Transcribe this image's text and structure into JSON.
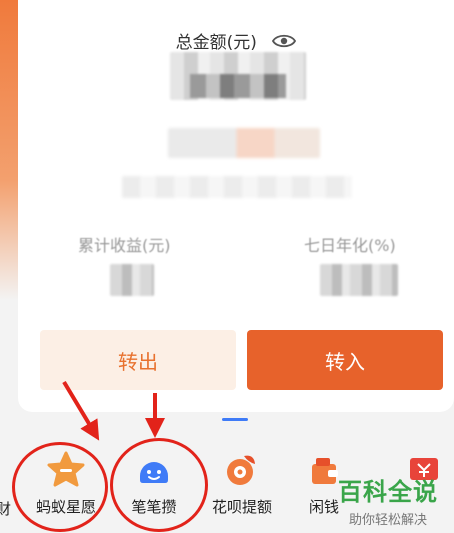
{
  "balance": {
    "title": "总金额(元)",
    "eye_icon": "eye-icon"
  },
  "stats": {
    "left_label": "累计收益(元)",
    "right_label": "七日年化(%)"
  },
  "actions": {
    "transfer_out": "转出",
    "transfer_in": "转入"
  },
  "nav": {
    "items": [
      {
        "label": "财",
        "icon": "partial-icon"
      },
      {
        "label": "蚂蚁星愿",
        "icon": "star-icon"
      },
      {
        "label": "笔笔攒",
        "icon": "smile-icon"
      },
      {
        "label": "花呗提额",
        "icon": "huabei-icon"
      },
      {
        "label": "闲钱",
        "icon": "wallet-icon"
      },
      {
        "label": "",
        "icon": "red-card-icon"
      }
    ]
  },
  "watermark": {
    "main": "百科全说",
    "sub": "助你轻松解决"
  },
  "colors": {
    "accent": "#e7622b",
    "accent_light": "#fcefe5",
    "annotation_red": "#e2231a",
    "blue_icon": "#3f7bf7",
    "watermark_green": "#3aa54a"
  }
}
